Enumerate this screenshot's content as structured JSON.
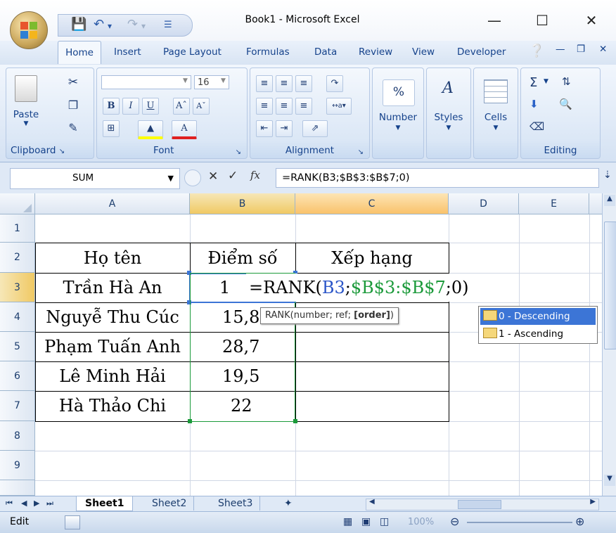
{
  "window": {
    "title": "Book1 - Microsoft Excel"
  },
  "tabs": [
    "Home",
    "Insert",
    "Page Layout",
    "Formulas",
    "Data",
    "Review",
    "View",
    "Developer"
  ],
  "ribbon": {
    "clipboard": {
      "paste_label": "Paste",
      "group_label": "Clipboard"
    },
    "font": {
      "font_name": "",
      "font_size": "16",
      "group_label": "Font"
    },
    "alignment": {
      "group_label": "Alignment"
    },
    "number": {
      "label": "Number",
      "symbol": "%"
    },
    "styles": {
      "label": "Styles"
    },
    "cells": {
      "label": "Cells"
    },
    "editing": {
      "group_label": "Editing",
      "sigma": "Σ"
    }
  },
  "formula_bar": {
    "name_box": "SUM",
    "fx": "fx",
    "formula": "=RANK(B3;$B$3:$B$7;0)"
  },
  "columns": [
    "A",
    "B",
    "C",
    "D",
    "E"
  ],
  "rows": [
    "1",
    "2",
    "3",
    "4",
    "5",
    "6",
    "7",
    "8",
    "9"
  ],
  "cells": {
    "A2": "Họ tên",
    "B2": "Điểm số",
    "C2": "Xếp hạng",
    "A3": "Trần Hà An",
    "B3": "1",
    "A4": "Nguyễ Thu Cúc",
    "B4": "15,8",
    "A5": "Phạm Tuấn Anh",
    "B5": "28,7",
    "A6": "Lê Minh Hải",
    "B6": "19,5",
    "A7": "Hà Thảo Chi",
    "B7": "22"
  },
  "in_cell_formula": {
    "prefix": "=RANK(",
    "ref1": "B3",
    "sep1": ";",
    "ref2": "$B$3:$B$7",
    "suffix": ";0)"
  },
  "tooltip": {
    "text_plain": "RANK(number; ref; ",
    "text_bold": "[order]",
    "text_end": ")"
  },
  "autocomplete": [
    {
      "label": "0 - Descending",
      "selected": true
    },
    {
      "label": "1 - Ascending",
      "selected": false
    }
  ],
  "sheet_tabs": [
    "Sheet1",
    "Sheet2",
    "Sheet3"
  ],
  "status": {
    "mode": "Edit",
    "zoom": "100%"
  },
  "colors": {
    "ref1": "#2a55c8",
    "ref2": "#1b9a3a",
    "selection": "#3c75d6"
  }
}
